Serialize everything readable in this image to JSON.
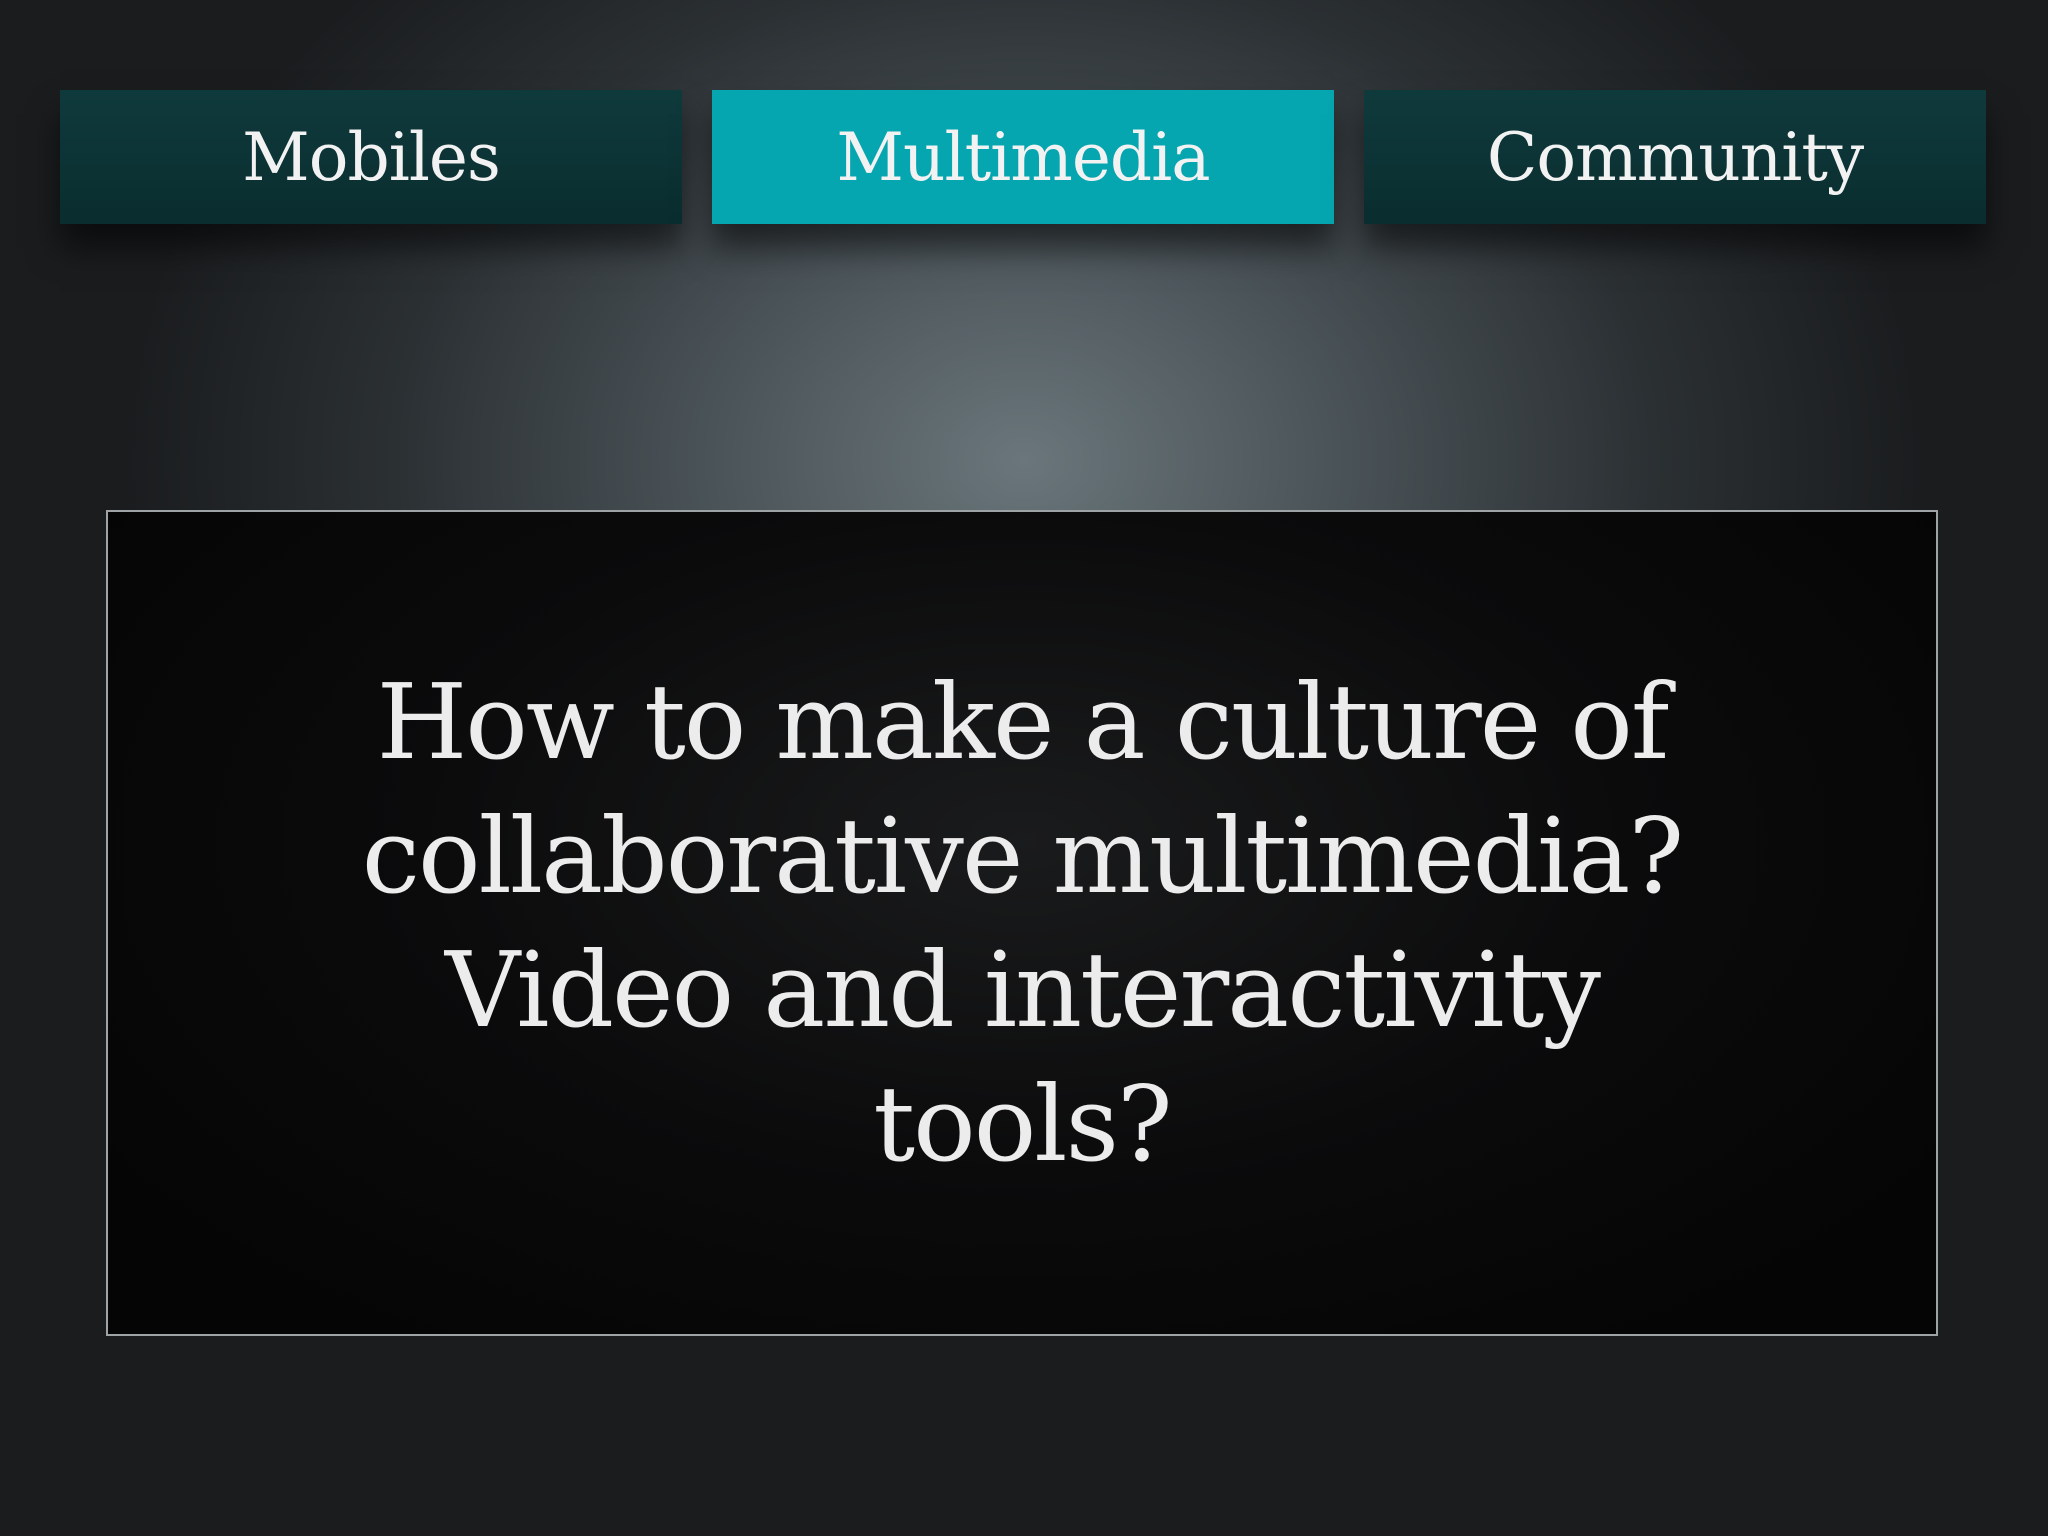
{
  "tabs": [
    {
      "label": "Mobiles",
      "active": false
    },
    {
      "label": "Multimedia",
      "active": true
    },
    {
      "label": "Community",
      "active": false
    }
  ],
  "question": {
    "lines": [
      "How to make a culture of",
      "collaborative multimedia?",
      "Video and interactivity",
      "tools?"
    ]
  },
  "colors": {
    "tab_inactive": "#0a2d2f",
    "tab_active": "#06a6b0",
    "box_background": "#0b0b0c",
    "text": "#ececec"
  }
}
